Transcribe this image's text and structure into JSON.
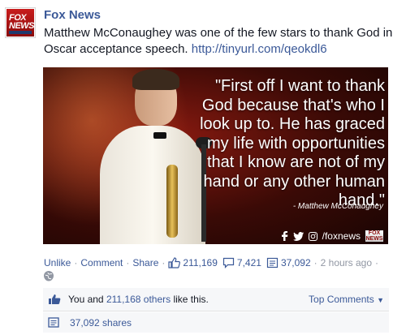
{
  "post": {
    "author": "Fox News",
    "avatar_text_line1": "FOX",
    "avatar_text_line2": "NEWS",
    "message_text": "Matthew McConaughey was one of the few stars to thank God in Oscar acceptance speech.",
    "message_link": "http://tinyurl.com/qeokdl6"
  },
  "photo": {
    "quote": "\"First off I want to thank God because that's who I look up to. He has graced my life with opportunities that I know are not of my hand or any other human hand.\"",
    "attribution": "- Matthew McConaughey",
    "brand_text": "/foxnews",
    "brand_icons": [
      "facebook-icon",
      "twitter-icon",
      "instagram-icon"
    ]
  },
  "actions": {
    "unlike": "Unlike",
    "comment": "Comment",
    "share": "Share",
    "likes_count": "211,169",
    "comments_count": "7,421",
    "shares_count": "37,092",
    "timestamp": "2 hours ago"
  },
  "likes_summary": {
    "prefix": "You and",
    "others_link": "211,168 others",
    "suffix": "like this.",
    "top_comments": "Top Comments"
  },
  "shares_summary": {
    "label": "37,092 shares"
  },
  "colors": {
    "link": "#3b5998",
    "muted": "#9197a3",
    "panel_bg": "#f6f7f9"
  }
}
